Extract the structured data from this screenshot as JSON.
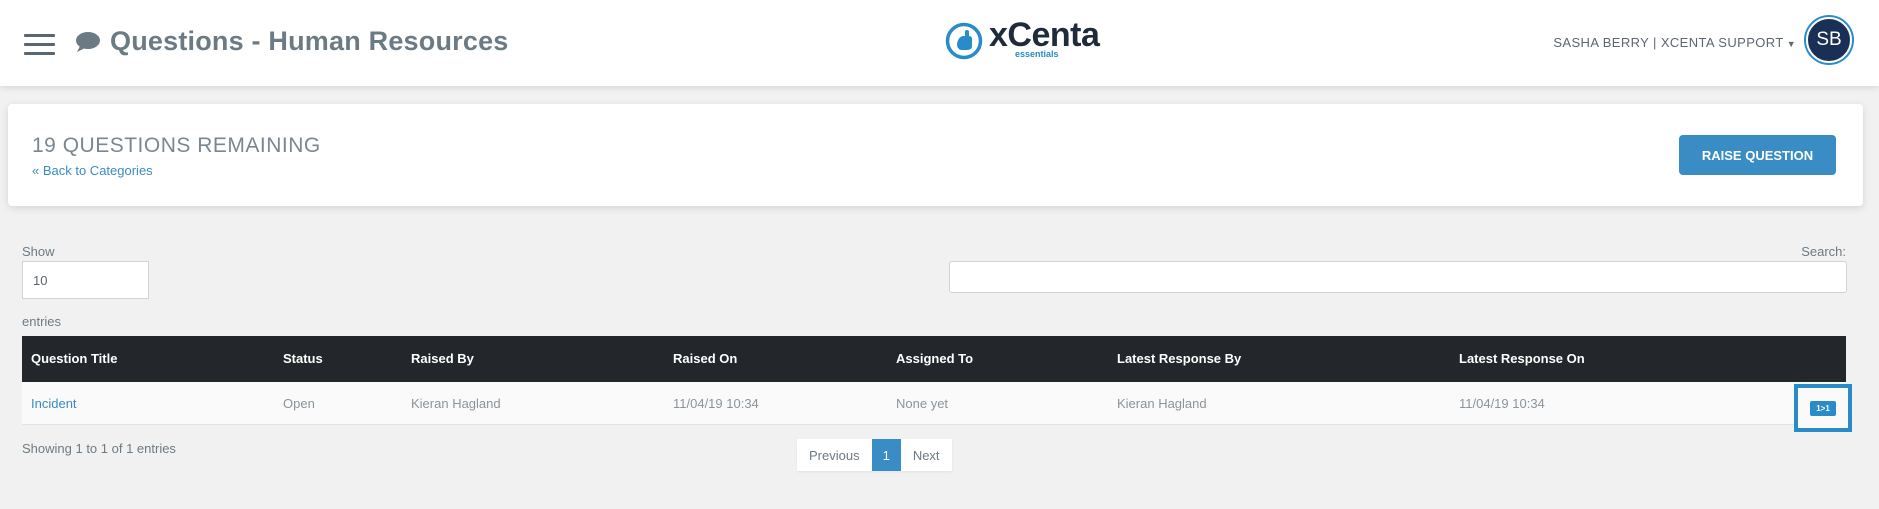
{
  "header": {
    "title": "Questions - Human Resources",
    "logo_text": "xCenta",
    "logo_sub": "essentials",
    "user_menu": "SASHA BERRY | XCENTA SUPPORT",
    "avatar_initials": "SB"
  },
  "panel": {
    "remaining": "19 QUESTIONS REMAINING",
    "back_link": "« Back to Categories",
    "raise_button": "RAISE QUESTION"
  },
  "controls": {
    "show_label": "Show",
    "show_value": "10",
    "entries_label": "entries",
    "search_label": "Search:"
  },
  "table": {
    "columns": [
      "Question Title",
      "Status",
      "Raised By",
      "Raised On",
      "Assigned To",
      "Latest Response By",
      "Latest Response On"
    ],
    "rows": [
      {
        "title": "Incident",
        "status": "Open",
        "raised_by": "Kieran Hagland",
        "raised_on": "11/04/19 10:34",
        "assigned_to": "None yet",
        "latest_response_by": "Kieran Hagland",
        "latest_response_on": "11/04/19 10:34",
        "action_label": "1>1"
      }
    ]
  },
  "footer": {
    "showing": "Showing 1 to 1 of 1 entries",
    "previous": "Previous",
    "page": "1",
    "next": "Next"
  },
  "colors": {
    "accent": "#3a8cc4",
    "header_row": "#23262a",
    "avatar": "#1a2f56",
    "background": "#f1f1f1"
  },
  "icons": {
    "menu": "hamburger-menu-icon",
    "title": "chat-bubble-icon",
    "logo": "xcenta-logo-icon",
    "dropdown": "caret-down-icon"
  }
}
